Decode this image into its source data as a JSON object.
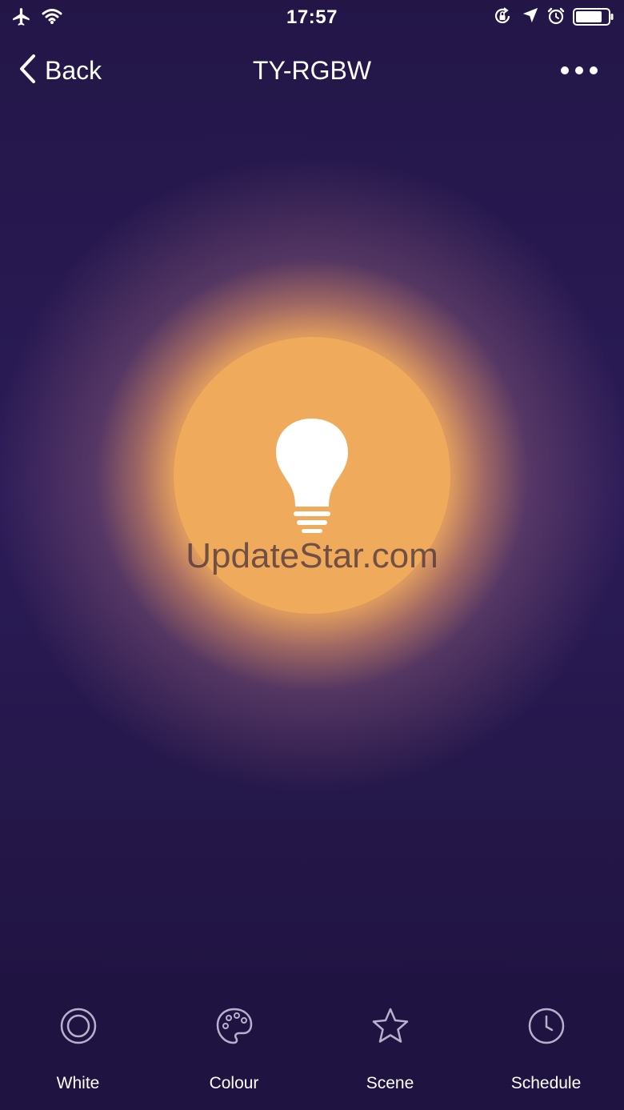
{
  "status_bar": {
    "time": "17:57",
    "icons": [
      "airplane-icon",
      "wifi-icon",
      "rotation-lock-icon",
      "location-icon",
      "alarm-icon",
      "battery-icon"
    ]
  },
  "nav": {
    "back_label": "Back",
    "title": "TY-RGBW",
    "more_icon": "more-dots-icon"
  },
  "bulb": {
    "icon": "lightbulb-icon",
    "color": "#f0aa5c"
  },
  "watermark": "UpdateStar.com",
  "tabs": [
    {
      "label": "White",
      "icon": "white-ring-icon"
    },
    {
      "label": "Colour",
      "icon": "palette-icon"
    },
    {
      "label": "Scene",
      "icon": "star-icon"
    },
    {
      "label": "Schedule",
      "icon": "clock-icon"
    }
  ],
  "colors": {
    "background": "#221644",
    "accent": "#f0aa5c",
    "tab_icon": "#b8b0cc"
  }
}
